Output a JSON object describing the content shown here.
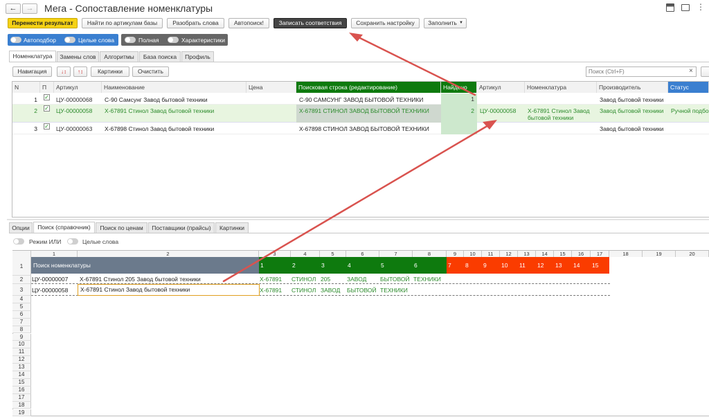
{
  "window": {
    "title": "Мега - Сопоставление номенклатуры",
    "back_icon": "←",
    "forward_icon": "→",
    "save_icon": "💾",
    "print_icon": "⎙",
    "menu_icon": "⋮"
  },
  "toolbar": {
    "transfer": "Перенести результат",
    "find_articles": "Найти по артикулам базы",
    "parse_words": "Разобрать слова",
    "autosearch": "Автопоиск!",
    "write_matches": "Записать соответствия",
    "save_settings": "Сохранить настройку",
    "fill": "Заполнить"
  },
  "toggles": {
    "autoselect": "Автоподбор",
    "whole_words": "Целые слова",
    "full": "Полная",
    "characteristics": "Характеристики"
  },
  "tabs": [
    "Номенклатура",
    "Замены слов",
    "Алгоритмы",
    "База поиска",
    "Профиль"
  ],
  "list_toolbar": {
    "navigation": "Навигация",
    "pictures": "Картинки",
    "clear": "Очистить",
    "search_placeholder": "Поиск (Ctrl+F)",
    "clear_icon": "×"
  },
  "table": {
    "headers": {
      "n": "N",
      "p": "П",
      "article": "Артикул",
      "name": "Наименование",
      "price": "Цена",
      "search_string": "Поисковая строка (редактирование)",
      "found": "Найдено",
      "article2": "Артикул",
      "nomenclature": "Номенклатура",
      "manufacturer": "Производитель",
      "status": "Статус"
    },
    "rows": [
      {
        "n": "1",
        "article": "ЦУ-00000068",
        "name": "С-90 Самсунг Завод бытовой техники",
        "search": "С-90 САМСУНГ ЗАВОД БЫТОВОЙ ТЕХНИКИ",
        "found": "1",
        "article2": "",
        "nom1": "",
        "nom2": "",
        "manufacturer": "Завод бытовой техники",
        "status": ""
      },
      {
        "n": "2",
        "article": "ЦУ-00000058",
        "name": "Х-67891 Стинол Завод бытовой техники",
        "search": "Х-67891 СТИНОЛ ЗАВОД БЫТОВОЙ ТЕХНИКИ",
        "found": "2",
        "article2": "ЦУ-00000058",
        "nom1": "Х-67891 Стинол Завод",
        "nom2": "бытовой техники",
        "manufacturer": "Завод бытовой техники",
        "status": "Ручной подбо"
      },
      {
        "n": "3",
        "article": "ЦУ-00000063",
        "name": "Х-67898 Стинол Завод бытовой техники",
        "search": "Х-67898 СТИНОЛ ЗАВОД БЫТОВОЙ ТЕХНИКИ",
        "found": "",
        "article2": "",
        "nom1": "",
        "nom2": "",
        "manufacturer": "Завод бытовой техники",
        "status": ""
      }
    ]
  },
  "bottom_tabs": [
    "Опции",
    "Поиск (справочник)",
    "Поиск по ценам",
    "Поставщики (прайсы)",
    "Картинки"
  ],
  "bottom_toggles": {
    "or_mode": "Режим ИЛИ",
    "whole_words": "Целые слова"
  },
  "sheet": {
    "col_numbers": [
      "1",
      "2",
      "3",
      "4",
      "5",
      "6",
      "7",
      "8",
      "9",
      "10",
      "11",
      "12",
      "13",
      "14",
      "15",
      "16",
      "17",
      "18",
      "19",
      "20"
    ],
    "row_numbers": [
      "1",
      "2",
      "3",
      "4",
      "5",
      "6",
      "7",
      "8",
      "9",
      "10",
      "11",
      "12",
      "13",
      "14",
      "15",
      "16",
      "17",
      "18",
      "19"
    ],
    "header_label": "Поиск номенклатуры",
    "green_nums": [
      "1",
      "2",
      "3",
      "4",
      "5",
      "6"
    ],
    "red_nums": [
      "7",
      "8",
      "9",
      "10",
      "11",
      "12",
      "13",
      "14",
      "15"
    ],
    "row2": {
      "article": "ЦУ-00000007",
      "name": "Х-67891 Стинол 205 Завод бытовой техники",
      "words": [
        "Х-67891",
        "СТИНОЛ",
        "205",
        "ЗАВОД",
        "БЫТОВОЙ",
        "ТЕХНИКИ"
      ]
    },
    "row3": {
      "article": "ЦУ-00000058",
      "name": "Х-67891 Стинол Завод бытовой техники",
      "words": [
        "Х-67891",
        "СТИНОЛ",
        "ЗАВОД",
        "БЫТОВОЙ",
        "ТЕХНИКИ"
      ]
    }
  },
  "colors": {
    "accent_yellow": "#f5d213",
    "green_header": "#0e7a0e",
    "orange_red": "#fa3c00",
    "blue_toggle": "#3a7fd0",
    "arrow_red": "#d9534f",
    "match_text": "#2a8a2a"
  }
}
